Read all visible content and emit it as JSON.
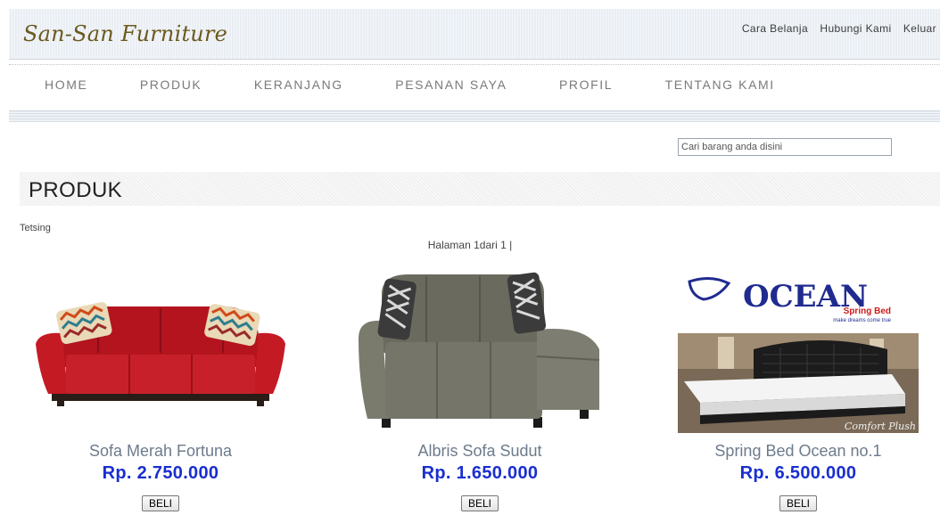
{
  "header": {
    "logo": "San-San Furniture",
    "links": [
      "Cara Belanja",
      "Hubungi Kami",
      "Keluar"
    ]
  },
  "nav": [
    "HOME",
    "PRODUK",
    "KERANJANG",
    "PESANAN SAYA",
    "PROFIL",
    "TENTANG KAMI"
  ],
  "search": {
    "placeholder": "Cari barang anda disini"
  },
  "section": {
    "title": "PRODUK"
  },
  "note": "Tetsing",
  "pager": "Halaman 1dari 1 |",
  "products": [
    {
      "name": "Sofa Merah Fortuna",
      "price": "Rp. 2.750.000",
      "button": "BELI",
      "image": "red-sofa"
    },
    {
      "name": "Albris Sofa Sudut",
      "price": "Rp. 1.650.000",
      "button": "BELI",
      "image": "grey-sectional-sofa"
    },
    {
      "name": "Spring Bed Ocean no.1",
      "price": "Rp. 6.500.000",
      "button": "BELI",
      "image": "ocean-spring-bed",
      "image_text": {
        "brand": "OCEAN",
        "sub": "Spring Bed",
        "tagline": "make dreams come true",
        "caption": "Comfort Plush"
      }
    }
  ]
}
